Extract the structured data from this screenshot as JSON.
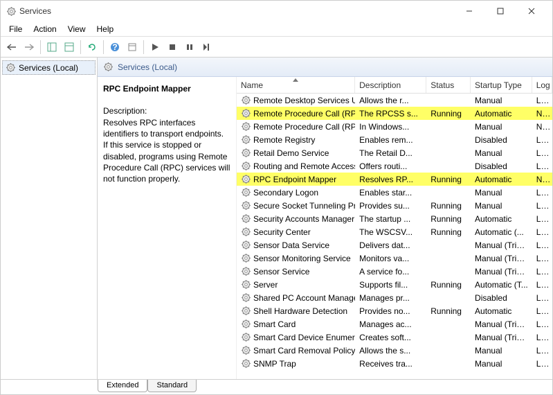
{
  "window": {
    "title": "Services"
  },
  "menu": {
    "file": "File",
    "action": "Action",
    "view": "View",
    "help": "Help"
  },
  "tree": {
    "root": "Services (Local)"
  },
  "content": {
    "header": "Services (Local)"
  },
  "detail": {
    "title": "RPC Endpoint Mapper",
    "desc_label": "Description:",
    "desc_text": "Resolves RPC interfaces identifiers to transport endpoints. If this service is stopped or disabled, programs using Remote Procedure Call (RPC) services will not function properly."
  },
  "columns": {
    "name": "Name",
    "description": "Description",
    "status": "Status",
    "startup": "Startup Type",
    "logon": "Log On As"
  },
  "tabs": {
    "extended": "Extended",
    "standard": "Standard"
  },
  "services": [
    {
      "name": "Remote Desktop Services U...",
      "desc": "Allows the r...",
      "status": "",
      "startup": "Manual",
      "logon": "Loca",
      "hi": false
    },
    {
      "name": "Remote Procedure Call (RPC)",
      "desc": "The RPCSS s...",
      "status": "Running",
      "startup": "Automatic",
      "logon": "Netv",
      "hi": true
    },
    {
      "name": "Remote Procedure Call (RP...",
      "desc": "In Windows...",
      "status": "",
      "startup": "Manual",
      "logon": "Netv",
      "hi": false
    },
    {
      "name": "Remote Registry",
      "desc": "Enables rem...",
      "status": "",
      "startup": "Disabled",
      "logon": "Loca",
      "hi": false
    },
    {
      "name": "Retail Demo Service",
      "desc": "The Retail D...",
      "status": "",
      "startup": "Manual",
      "logon": "Loca",
      "hi": false
    },
    {
      "name": "Routing and Remote Access",
      "desc": "Offers routi...",
      "status": "",
      "startup": "Disabled",
      "logon": "Loca",
      "hi": false
    },
    {
      "name": "RPC Endpoint Mapper",
      "desc": "Resolves RP...",
      "status": "Running",
      "startup": "Automatic",
      "logon": "Netv",
      "hi": true
    },
    {
      "name": "Secondary Logon",
      "desc": "Enables star...",
      "status": "",
      "startup": "Manual",
      "logon": "Loca",
      "hi": false
    },
    {
      "name": "Secure Socket Tunneling Pr...",
      "desc": "Provides su...",
      "status": "Running",
      "startup": "Manual",
      "logon": "Loca",
      "hi": false
    },
    {
      "name": "Security Accounts Manager",
      "desc": "The startup ...",
      "status": "Running",
      "startup": "Automatic",
      "logon": "Loca",
      "hi": false
    },
    {
      "name": "Security Center",
      "desc": "The WSCSV...",
      "status": "Running",
      "startup": "Automatic (...",
      "logon": "Loca",
      "hi": false
    },
    {
      "name": "Sensor Data Service",
      "desc": "Delivers dat...",
      "status": "",
      "startup": "Manual (Trig...",
      "logon": "Loca",
      "hi": false
    },
    {
      "name": "Sensor Monitoring Service",
      "desc": "Monitors va...",
      "status": "",
      "startup": "Manual (Trig...",
      "logon": "Loca",
      "hi": false
    },
    {
      "name": "Sensor Service",
      "desc": "A service fo...",
      "status": "",
      "startup": "Manual (Trig...",
      "logon": "Loca",
      "hi": false
    },
    {
      "name": "Server",
      "desc": "Supports fil...",
      "status": "Running",
      "startup": "Automatic (T...",
      "logon": "Loca",
      "hi": false
    },
    {
      "name": "Shared PC Account Manager",
      "desc": "Manages pr...",
      "status": "",
      "startup": "Disabled",
      "logon": "Loca",
      "hi": false
    },
    {
      "name": "Shell Hardware Detection",
      "desc": "Provides no...",
      "status": "Running",
      "startup": "Automatic",
      "logon": "Loca",
      "hi": false
    },
    {
      "name": "Smart Card",
      "desc": "Manages ac...",
      "status": "",
      "startup": "Manual (Trig...",
      "logon": "Loca",
      "hi": false
    },
    {
      "name": "Smart Card Device Enumera...",
      "desc": "Creates soft...",
      "status": "",
      "startup": "Manual (Trig...",
      "logon": "Loca",
      "hi": false
    },
    {
      "name": "Smart Card Removal Policy",
      "desc": "Allows the s...",
      "status": "",
      "startup": "Manual",
      "logon": "Loca",
      "hi": false
    },
    {
      "name": "SNMP Trap",
      "desc": "Receives tra...",
      "status": "",
      "startup": "Manual",
      "logon": "Loca",
      "hi": false
    }
  ]
}
